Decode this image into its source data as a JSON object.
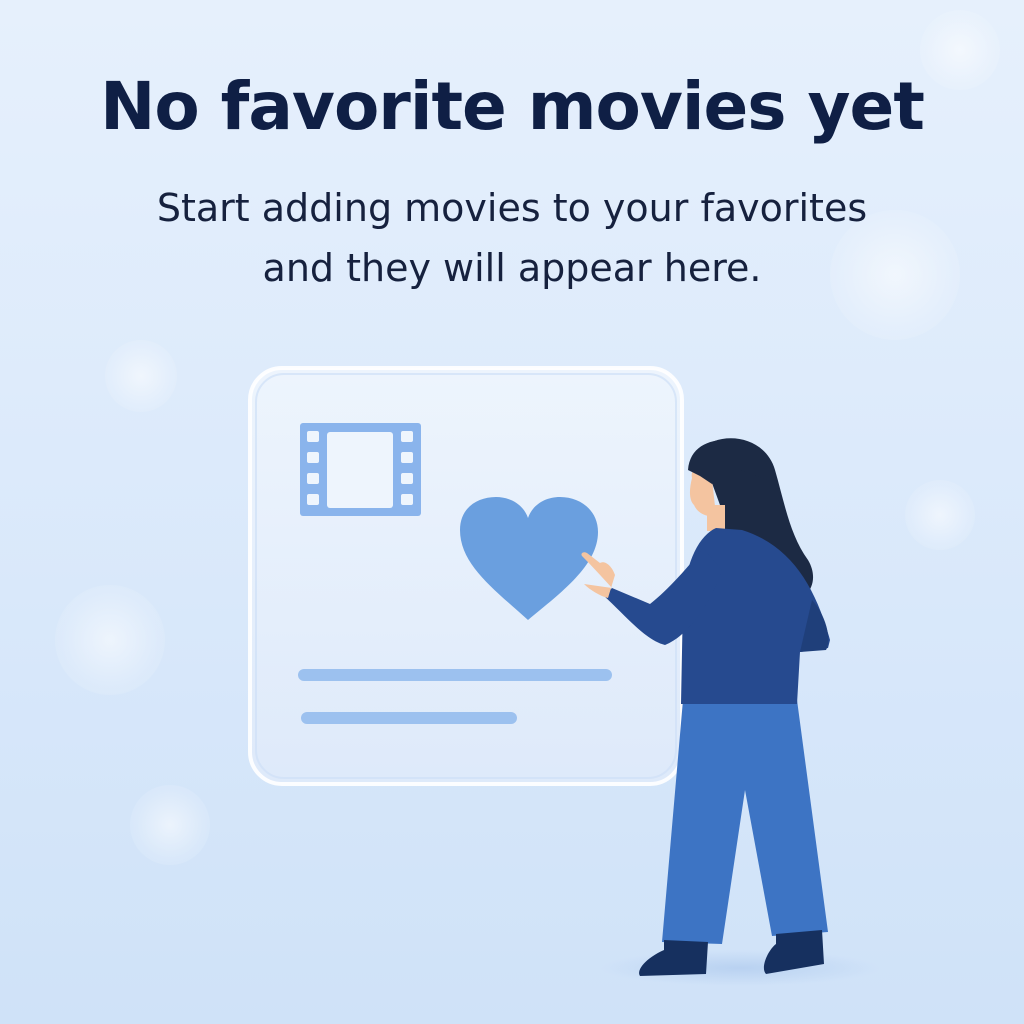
{
  "empty_state": {
    "title": "No favorite movies yet",
    "message_line1": "Start adding movies to your favorites",
    "message_line2": "and they will appear here."
  },
  "illustration": {
    "card_icon": "film-strip-icon",
    "action_icon": "heart-icon",
    "figure": "person-pointing"
  },
  "colors": {
    "background": "#dceafb",
    "title": "#0f1f45",
    "text": "#16213e",
    "heart": "#6a9fdf",
    "film_strip": "#8ab4ec",
    "card_lines": "#9cc1ef",
    "hair": "#1c2a44",
    "shirt": "#264a8f",
    "pants": "#3d74c4",
    "shoes": "#16305f",
    "skin": "#f4c4a0"
  }
}
